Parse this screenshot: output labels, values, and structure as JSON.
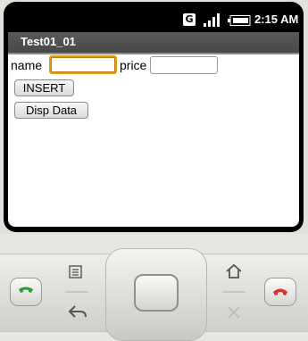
{
  "status_bar": {
    "network_badge": "G",
    "time": "2:15 AM",
    "icons": [
      "g-network-icon",
      "signal-icon",
      "battery-icon"
    ]
  },
  "app": {
    "title": "Test01_01"
  },
  "form": {
    "name_label": "name",
    "name_value": "",
    "price_label": "price",
    "price_value": "",
    "insert_button": "INSERT",
    "disp_button": "Disp Data"
  },
  "hardware": {
    "buttons": [
      "call-icon",
      "menu-icon",
      "back-icon",
      "home-icon",
      "search-icon",
      "end-call-icon"
    ],
    "colors": {
      "call": "#2f9a3a",
      "end_call": "#d2342a",
      "focus": "#e59b13"
    }
  }
}
